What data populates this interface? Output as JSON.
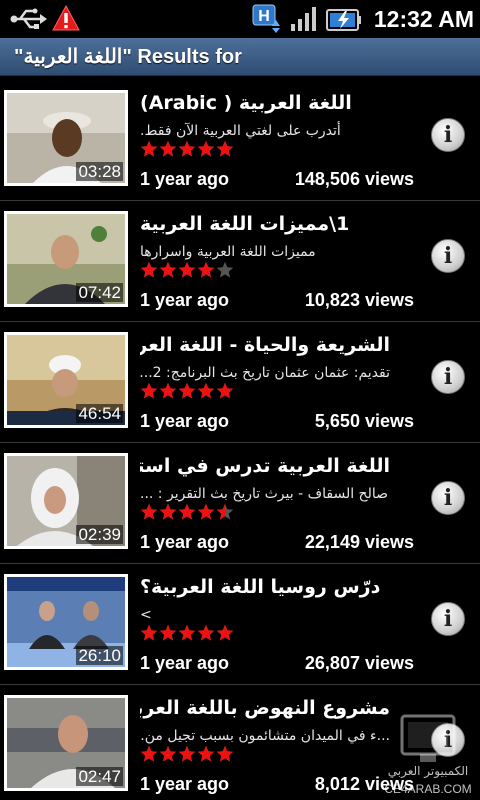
{
  "status_bar": {
    "time": "12:32 AM",
    "icons": [
      "usb-icon",
      "warning-icon",
      "hsdpa-icon",
      "signal-icon",
      "battery-icon"
    ],
    "network_label": "H"
  },
  "header": {
    "title": "Results for \"اللغة العربية\""
  },
  "colors": {
    "title_bar": "#3d5e88",
    "star_filled": "#ee1111",
    "star_empty": "#555555",
    "background": "#000000"
  },
  "results": [
    {
      "title": "اللغة العربية ( Arabic)",
      "description": "أتدرب على لغتي العربية الآن فقط.",
      "rating": 5,
      "age": "1 year ago",
      "views": "148,506 views",
      "duration": "03:28"
    },
    {
      "title": "1\\مميزات اللغة العربية",
      "description": "مميزات اللغة العربية واسرارها",
      "rating": 4,
      "age": "1 year ago",
      "views": "10,823 views",
      "duration": "07:42"
    },
    {
      "title": "الشريعة والحياة - اللغة العربية ...",
      "description": "تقديم: عثمان عثمان تاريخ بث البرنامج: 2...",
      "rating": 5,
      "age": "1 year ago",
      "views": "5,650 views",
      "duration": "46:54"
    },
    {
      "title": "اللغة العربية تدرس في استراليا",
      "description": "صالح السقاف - بيرث تاريخ بث التقرير : ...",
      "rating": 4.5,
      "age": "1 year ago",
      "views": "22,149 views",
      "duration": "02:39"
    },
    {
      "title": "درّس روسيا اللغة العربية؟",
      "description": ">",
      "rating": 5,
      "age": "1 year ago",
      "views": "26,807 views",
      "duration": "26:10"
    },
    {
      "title": "مشروع النهوض باللغة العربية",
      "description": "...ء في الميدان متشائمون بسبب تجيل من...",
      "rating": 5,
      "age": "1 year ago",
      "views": "8,012 views",
      "duration": "02:47"
    }
  ],
  "watermark": {
    "line1": "الكمبيوتر العربي",
    "line2": "CE4ARAB.COM"
  }
}
